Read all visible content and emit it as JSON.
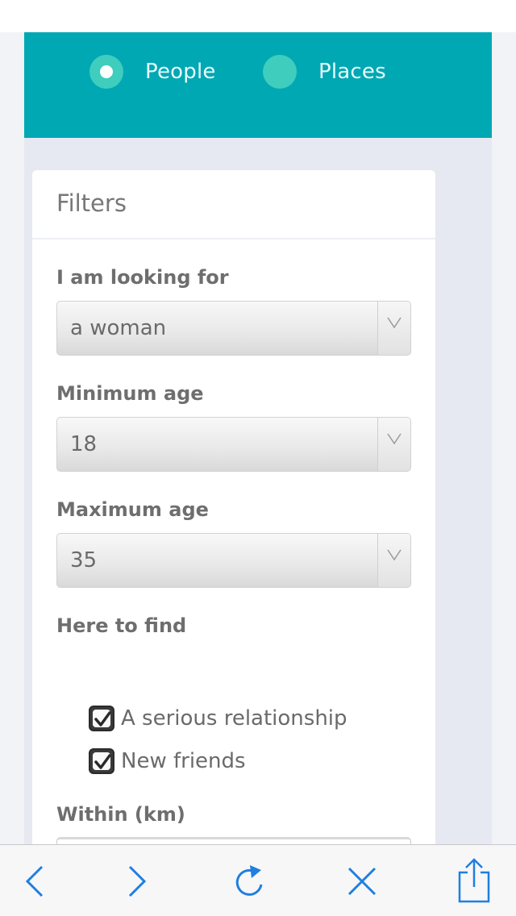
{
  "tabs": {
    "people_label": "People",
    "places_label": "Places",
    "selected": "People"
  },
  "filters": {
    "title": "Filters",
    "looking_for": {
      "label": "I am looking for",
      "value": "a woman"
    },
    "min_age": {
      "label": "Minimum age",
      "value": "18"
    },
    "max_age": {
      "label": "Maximum age",
      "value": "35"
    },
    "here_to_find": {
      "label": "Here to find",
      "options": [
        {
          "label": "A serious relationship",
          "checked": true
        },
        {
          "label": "New friends",
          "checked": true
        }
      ]
    },
    "within": {
      "label": "Within (km)",
      "value": ""
    }
  },
  "toolbar": {
    "icons": [
      "back-icon",
      "forward-icon",
      "reload-icon",
      "close-icon",
      "share-icon"
    ],
    "accent_color": "#1f7fe0"
  },
  "colors": {
    "header_teal": "#00a8b4",
    "radio_teal": "#3fcdbd"
  }
}
